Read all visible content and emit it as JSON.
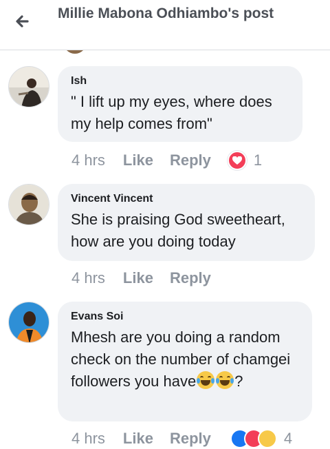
{
  "header": {
    "title": "Millie Mabona Odhiambo's post"
  },
  "comments": [
    {
      "author": "Ish",
      "text": "\" I lift up my eyes, where does my help comes from\"",
      "time": "4 hrs",
      "like": "Like",
      "reply": "Reply",
      "reaction_count": "1"
    },
    {
      "author": "Vincent Vincent",
      "text": "She is praising God sweetheart, how are you doing today",
      "time": "4 hrs",
      "like": "Like",
      "reply": "Reply"
    },
    {
      "author": "Evans Soi",
      "text_prefix": "Mhesh are you doing a random check on the number of chamgei followers you have",
      "text_suffix": "?",
      "time": "4 hrs",
      "like": "Like",
      "reply": "Reply",
      "reaction_count": "4"
    }
  ],
  "colors": {
    "love": "#f33e58",
    "like_blue": "#1877f2",
    "muted": "#8d949e"
  }
}
